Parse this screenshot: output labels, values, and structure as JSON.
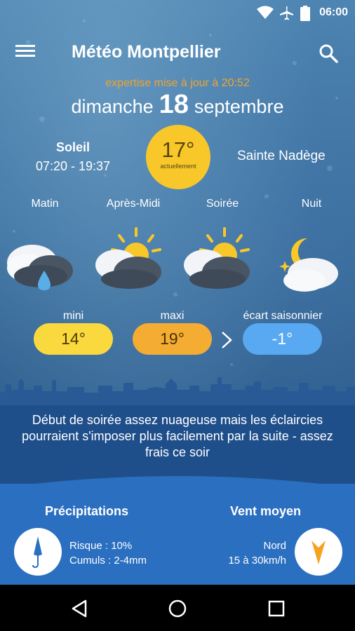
{
  "status_bar": {
    "time": "06:00",
    "icons": [
      "wifi-icon",
      "airplane-mode-icon",
      "battery-icon"
    ]
  },
  "app_bar": {
    "title": "Météo Montpellier",
    "menu_icon": "hamburger-menu-icon",
    "search_icon": "search-icon"
  },
  "header": {
    "update_text": "expertise mise à jour à 20:52",
    "weekday": "dimanche",
    "day": "18",
    "month": "septembre"
  },
  "sun": {
    "label": "Soleil",
    "hours": "07:20 - 19:37"
  },
  "current": {
    "temperature": "17°",
    "caption": "actuellement"
  },
  "saint": "Sainte Nadège",
  "periods": [
    {
      "label": "Matin",
      "icon": "cloud-rain-drop-icon"
    },
    {
      "label": "Après-Midi",
      "icon": "sun-behind-dark-clouds-icon"
    },
    {
      "label": "Soirée",
      "icon": "sun-behind-dark-clouds-icon"
    },
    {
      "label": "Nuit",
      "icon": "moon-with-clouds-icon"
    }
  ],
  "temps": {
    "mini_label": "mini",
    "mini_value": "14°",
    "maxi_label": "maxi",
    "maxi_value": "19°",
    "ecart_label": "écart saisonnier",
    "ecart_value": "-1°"
  },
  "forecast_text": "Début de soirée assez nuageuse mais les éclaircies pourraient s'imposer plus facilement par la suite - assez frais ce soir",
  "precipitations": {
    "title": "Précipitations",
    "risk": "Risque : 10%",
    "cumuls": "Cumuls : 2-4mm",
    "icon": "closed-umbrella-icon"
  },
  "wind": {
    "title": "Vent moyen",
    "direction": "Nord",
    "speed": "15 à 30km/h",
    "icon": "wind-direction-arrow-icon"
  },
  "colors": {
    "accent_orange": "#f0a430",
    "now_circle": "#f8c82a",
    "mini": "#f9d93d",
    "maxi": "#f5ac33",
    "ecart": "#58a9f1",
    "panel": "#2b6fc0"
  },
  "nav": [
    "back-icon",
    "home-icon",
    "recents-icon"
  ]
}
